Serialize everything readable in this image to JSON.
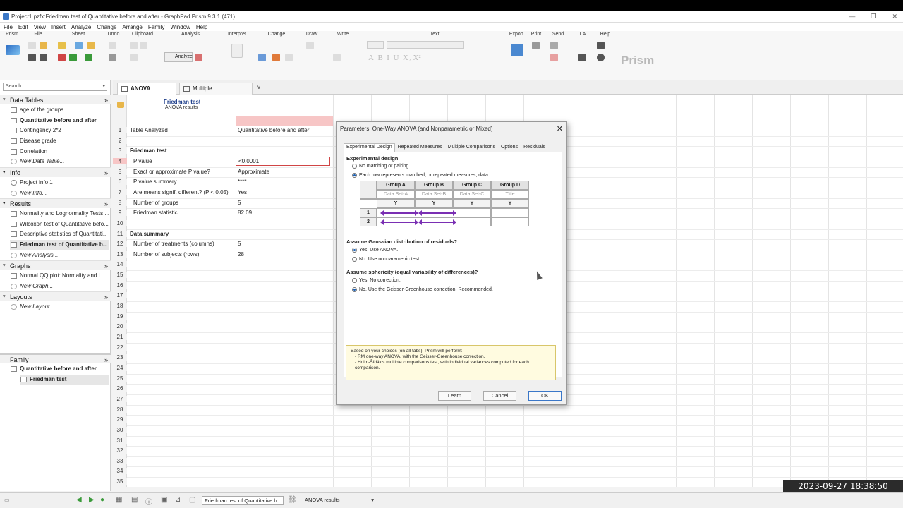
{
  "window": {
    "title": "Project1.pzfx:Friedman test of Quantitative before and after - GraphPad Prism 9.3.1 (471)"
  },
  "menu": [
    "File",
    "Edit",
    "View",
    "Insert",
    "Analyze",
    "Change",
    "Arrange",
    "Family",
    "Window",
    "Help"
  ],
  "ribbon": {
    "groups": [
      "Prism",
      "File",
      "Sheet",
      "Undo",
      "Clipboard",
      "Analysis",
      "Interpret",
      "Change",
      "Draw",
      "Write",
      "Text",
      "Export",
      "Print",
      "Send",
      "LA",
      "Help"
    ],
    "analyze_label": "Analyze",
    "brand": "Prism"
  },
  "nav": {
    "search_placeholder": "Search...",
    "data_tables": {
      "title": "Data Tables",
      "items": [
        "age of the groups",
        "Quantitative before and after",
        "Contingency 2*2",
        "Disease grade",
        "Correlation",
        "New Data Table..."
      ]
    },
    "info": {
      "title": "Info",
      "items": [
        "Project info 1",
        "New Info..."
      ]
    },
    "results": {
      "title": "Results",
      "items": [
        "Normality and Lognormality Tests ...",
        "Wilcoxon test of Quantitative befo...",
        "Descriptive statistics of Quantitati...",
        "Friedman test of Quantitative b...",
        "New Analysis..."
      ]
    },
    "graphs": {
      "title": "Graphs",
      "items": [
        "Normal QQ plot: Normality and L...",
        "New Graph..."
      ]
    },
    "layouts": {
      "title": "Layouts",
      "items": [
        "New Layout..."
      ]
    },
    "family": {
      "title": "Family",
      "items": [
        "Quantitative before and after",
        "Friedman test"
      ]
    }
  },
  "tabs": [
    "ANOVA results",
    "Multiple comparisons"
  ],
  "sheet": {
    "header_title": "Friedman test",
    "header_sub": "ANOVA results",
    "rows": [
      {
        "n": "1",
        "label": "Table Analyzed",
        "value": "Quantitative before and after",
        "kind": "label"
      },
      {
        "n": "2",
        "label": "",
        "value": ""
      },
      {
        "n": "3",
        "label": "Friedman test",
        "value": "",
        "kind": "section"
      },
      {
        "n": "4",
        "label": "P value",
        "value": "<0.0001",
        "kind": "indent"
      },
      {
        "n": "5",
        "label": "Exact or approximate P value?",
        "value": "Approximate",
        "kind": "indent"
      },
      {
        "n": "6",
        "label": "P value summary",
        "value": "****",
        "kind": "indent"
      },
      {
        "n": "7",
        "label": "Are means signif. different? (P < 0.05)",
        "value": "Yes",
        "kind": "indent"
      },
      {
        "n": "8",
        "label": "Number of groups",
        "value": "5",
        "kind": "indent"
      },
      {
        "n": "9",
        "label": "Friedman statistic",
        "value": "82.09",
        "kind": "indent"
      },
      {
        "n": "10",
        "label": "",
        "value": ""
      },
      {
        "n": "11",
        "label": "Data summary",
        "value": "",
        "kind": "section"
      },
      {
        "n": "12",
        "label": "Number of treatments (columns)",
        "value": "5",
        "kind": "indent"
      },
      {
        "n": "13",
        "label": "Number of subjects (rows)",
        "value": "28",
        "kind": "indent"
      },
      {
        "n": "14"
      },
      {
        "n": "15"
      },
      {
        "n": "16"
      },
      {
        "n": "17"
      },
      {
        "n": "18"
      },
      {
        "n": "19"
      },
      {
        "n": "20"
      },
      {
        "n": "21"
      },
      {
        "n": "22"
      },
      {
        "n": "23"
      },
      {
        "n": "24"
      },
      {
        "n": "25"
      },
      {
        "n": "26"
      },
      {
        "n": "27"
      },
      {
        "n": "28"
      },
      {
        "n": "29"
      },
      {
        "n": "30"
      },
      {
        "n": "31"
      },
      {
        "n": "32"
      },
      {
        "n": "33"
      },
      {
        "n": "34"
      },
      {
        "n": "35"
      }
    ]
  },
  "dialog": {
    "title": "Parameters: One-Way ANOVA (and Nonparametric or Mixed)",
    "tabs": [
      "Experimental Design",
      "Repeated Measures",
      "Multiple Comparisons",
      "Options",
      "Residuals"
    ],
    "exp_design": "Experimental design",
    "opt_no_matching": "No matching or pairing",
    "opt_matched": "Each row represents matched, or repeated measures, data",
    "table": {
      "groups": [
        "Group A",
        "Group B",
        "Group C",
        "Group D"
      ],
      "subs": [
        "Data Set-A",
        "Data Set-B",
        "Data Set-C",
        "Title"
      ],
      "y": "Y",
      "rows": [
        "1",
        "2"
      ]
    },
    "gauss_header": "Assume Gaussian distribution of residuals?",
    "gauss_yes": "Yes. Use ANOVA.",
    "gauss_no": "No. Use nonparametric test.",
    "spher_header": "Assume sphericity (equal variability of differences)?",
    "spher_yes": "Yes. No correction.",
    "spher_no": "No. Use the Geisser-Greenhouse correction. Recommended.",
    "info_line1": "Based on your choices (on all tabs), Prism will perform:",
    "info_line2": "- RM one-way ANOVA, with the Geisser-Greenhouse correction.",
    "info_line3": "- Holm-Šídák's multiple comparisons test, with individual variances computed for each comparison.",
    "btn_learn": "Learn",
    "btn_cancel": "Cancel",
    "btn_ok": "OK"
  },
  "status": {
    "sheet_select": "Friedman test of Quantitative b",
    "results_select": "ANOVA results"
  },
  "timestamp": "2023-09-27 18:38:50"
}
